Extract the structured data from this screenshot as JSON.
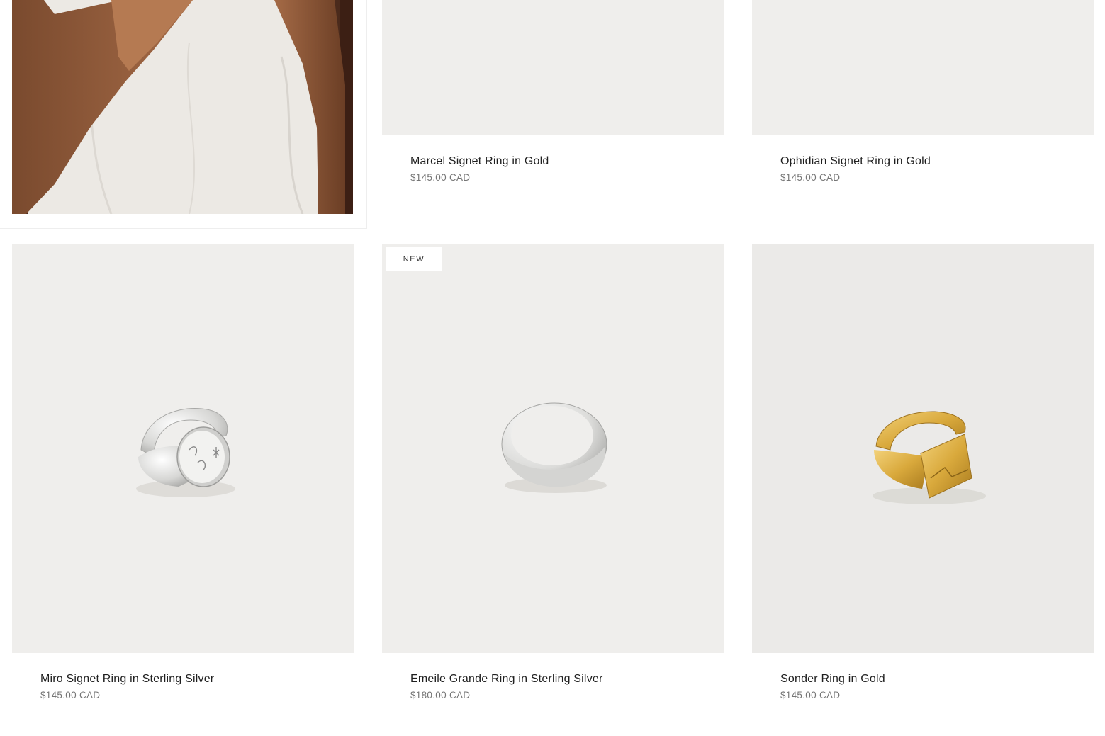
{
  "grid": {
    "products": [
      {
        "title": "Marcel Signet Ring in Gold",
        "price": "$145.00 CAD",
        "badge": ""
      },
      {
        "title": "Ophidian Signet Ring in Gold",
        "price": "$145.00 CAD",
        "badge": ""
      },
      {
        "title": "Miro Signet Ring in Sterling Silver",
        "price": "$145.00 CAD",
        "badge": ""
      },
      {
        "title": "Emeile Grande Ring in Sterling Silver",
        "price": "$180.00 CAD",
        "badge": "NEW"
      },
      {
        "title": "Sonder Ring in Gold",
        "price": "$145.00 CAD",
        "badge": ""
      }
    ]
  },
  "colors": {
    "page_background": "#ffffff",
    "image_background": "#efeeec",
    "title_text": "#1f1f1f",
    "price_text": "#757575",
    "silver": "#e4e4e4",
    "gold": "#d9a93c"
  },
  "icons": [
    "lifestyle-photo",
    "silver-signet-ring",
    "silver-dome-ring",
    "gold-signet-ring"
  ]
}
